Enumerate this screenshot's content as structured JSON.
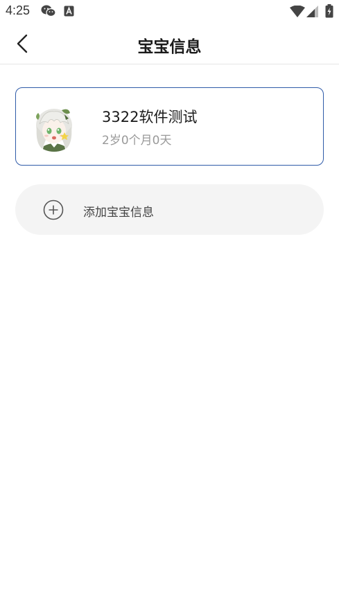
{
  "status_bar": {
    "time": "4:25",
    "icons": [
      "wechat-icon",
      "a-icon",
      "wifi-icon",
      "signal-icon",
      "battery-icon"
    ]
  },
  "header": {
    "title": "宝宝信息",
    "back_icon": "chevron-left-icon"
  },
  "baby_card": {
    "name": "3322软件测试",
    "age": "2岁0个月0天",
    "avatar": "anime-avatar",
    "border_color": "#2e5aa8"
  },
  "add_baby": {
    "label": "添加宝宝信息",
    "icon": "plus-circle-icon"
  }
}
